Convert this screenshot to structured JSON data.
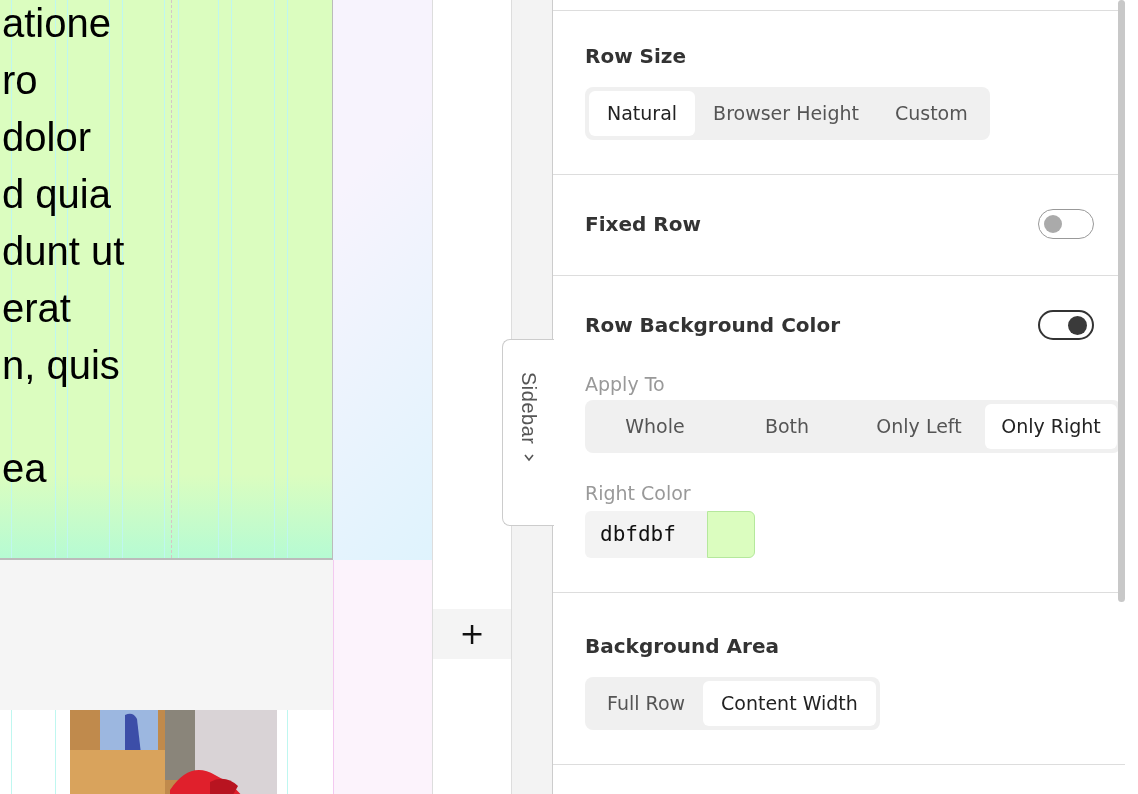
{
  "canvas": {
    "paragraphs": [
      [
        "atione",
        "ro",
        "dolor",
        "d quia",
        "dunt ut",
        "erat",
        "n, quis"
      ],
      [
        "ea"
      ]
    ],
    "photo": {
      "kind": "picture"
    }
  },
  "add_button": {
    "label": "+"
  },
  "sidebar_tab": {
    "label": "Sidebar"
  },
  "sections": [
    {
      "kind": "segmented",
      "title": "Row Size",
      "options": [
        {
          "label": "Natural",
          "selected": true
        },
        {
          "label": "Browser Height",
          "selected": false
        },
        {
          "label": "Custom",
          "selected": false
        }
      ]
    },
    {
      "kind": "toggle",
      "title": "Fixed Row",
      "on": false
    },
    {
      "kind": "toggle",
      "title": "Row Background Color",
      "on": true,
      "apply_to": {
        "label": "Apply To",
        "options": [
          {
            "label": "Whole",
            "selected": false
          },
          {
            "label": "Both",
            "selected": false
          },
          {
            "label": "Only Left",
            "selected": false
          },
          {
            "label": "Only Right",
            "selected": true
          }
        ]
      },
      "color_field": {
        "label": "Right Color",
        "value": "dbfdbf",
        "color": "#dbfdbf"
      }
    },
    {
      "kind": "segmented",
      "title": "Background Area",
      "options": [
        {
          "label": "Full Row",
          "selected": false
        },
        {
          "label": "Content Width",
          "selected": true
        }
      ]
    }
  ]
}
